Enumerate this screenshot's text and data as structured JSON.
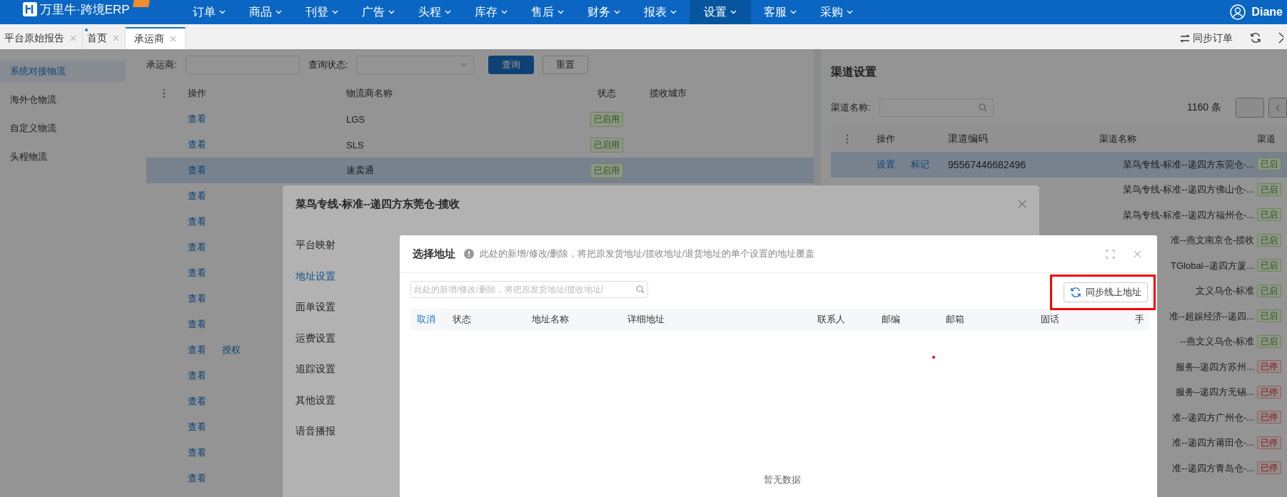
{
  "app": {
    "logo": "万里牛·跨境ERP",
    "user": "Diane"
  },
  "nav": [
    {
      "label": "订单",
      "selected": false
    },
    {
      "label": "商品",
      "selected": false
    },
    {
      "label": "刊登",
      "selected": false
    },
    {
      "label": "广告",
      "selected": false
    },
    {
      "label": "头程",
      "selected": false
    },
    {
      "label": "库存",
      "selected": false
    },
    {
      "label": "售后",
      "selected": false
    },
    {
      "label": "财务",
      "selected": false
    },
    {
      "label": "报表",
      "selected": false
    },
    {
      "label": "设置",
      "selected": true
    },
    {
      "label": "客服",
      "selected": false
    },
    {
      "label": "采购",
      "selected": false
    }
  ],
  "tabs": [
    {
      "label": "平台原始报告",
      "selected": false,
      "modified": false
    },
    {
      "label": "首页",
      "selected": false,
      "modified": true
    },
    {
      "label": "承运商",
      "selected": true,
      "modified": false
    }
  ],
  "tab_actions": {
    "sync": "同步订单"
  },
  "sidebar": {
    "items": [
      {
        "label": "系统对接物流",
        "selected": true
      },
      {
        "label": "海外仓物流",
        "selected": false
      },
      {
        "label": "自定义物流",
        "selected": false
      },
      {
        "label": "头程物流",
        "selected": false
      }
    ]
  },
  "carrier_search": {
    "carrier_label": "承运商:",
    "status_label": "查询状态:",
    "query": "查询",
    "reset": "重置"
  },
  "carrier_table": {
    "columns": [
      "操作",
      "物流商名称",
      "状态",
      "揽收城市"
    ],
    "rows": [
      {
        "actions": [
          "查看"
        ],
        "name": "LGS",
        "status": "已启用",
        "selected": false
      },
      {
        "actions": [
          "查看"
        ],
        "name": "SLS",
        "status": "已启用",
        "selected": false
      },
      {
        "actions": [
          "查看"
        ],
        "name": "速卖通",
        "status": "已启用",
        "selected": true
      },
      {
        "actions": [
          "查看"
        ],
        "selected": false
      },
      {
        "actions": [
          "查看"
        ],
        "selected": false
      },
      {
        "actions": [
          "查看"
        ],
        "selected": false
      },
      {
        "actions": [
          "查看"
        ],
        "selected": false
      },
      {
        "actions": [
          "查看"
        ],
        "selected": false
      },
      {
        "actions": [
          "查看"
        ],
        "selected": false
      },
      {
        "actions": [
          "查看",
          "授权"
        ],
        "selected": false
      },
      {
        "actions": [
          "查看"
        ],
        "selected": false
      },
      {
        "actions": [
          "查看"
        ],
        "selected": false
      },
      {
        "actions": [
          "查看"
        ],
        "selected": false
      },
      {
        "actions": [
          "查看"
        ],
        "selected": false
      },
      {
        "actions": [
          "查看"
        ],
        "selected": false
      }
    ]
  },
  "channel_panel": {
    "title": "渠道设置",
    "search_label": "渠道名称:",
    "total": "1160 条",
    "columns": [
      "操作",
      "渠道编码",
      "渠道名称",
      "渠道"
    ],
    "rows": [
      {
        "actions": [
          "设置",
          "标记"
        ],
        "code": "95567446682496",
        "name": "菜鸟专线-标准--递四方东莞仓-...",
        "status": "已启",
        "kind": "enabled",
        "selected": true
      },
      {
        "name": "菜鸟专线-标准--递四方佛山仓-...",
        "status": "已启",
        "kind": "enabled",
        "selected": false
      },
      {
        "name": "菜鸟专线-标准--递四方福州仓-...",
        "status": "已启",
        "kind": "enabled",
        "selected": false
      },
      {
        "name": "准--燕文南京仓-揽收",
        "status": "已启",
        "kind": "enabled",
        "selected": false
      },
      {
        "name": "TGlobal--递四方厦...",
        "status": "已启",
        "kind": "enabled",
        "selected": false
      },
      {
        "name": "文义乌仓-标准",
        "status": "已启",
        "kind": "enabled",
        "selected": false
      },
      {
        "name": "准--超娱经济--递四...",
        "status": "已启",
        "kind": "enabled",
        "selected": false
      },
      {
        "name": "--燕文义乌仓-标准",
        "status": "已启",
        "kind": "enabled",
        "selected": false
      },
      {
        "name": "服务--递四方苏州...",
        "status": "已停",
        "kind": "disabled",
        "selected": false
      },
      {
        "name": "服务--递四方无锡...",
        "status": "已停",
        "kind": "disabled",
        "selected": false
      },
      {
        "name": "准--递四方广州仓-...",
        "status": "已停",
        "kind": "disabled",
        "selected": false
      },
      {
        "name": "准--递四方莆田仓-...",
        "status": "已停",
        "kind": "disabled",
        "selected": false
      },
      {
        "name": "准--递四方青岛仓-...",
        "status": "已停",
        "kind": "disabled",
        "selected": false
      }
    ]
  },
  "carrier_dialog": {
    "title": "菜鸟专线-标准--递四方东莞仓-揽收",
    "menu": [
      {
        "label": "平台映射",
        "selected": false
      },
      {
        "label": "地址设置",
        "selected": true
      },
      {
        "label": "面单设置",
        "selected": false
      },
      {
        "label": "运费设置",
        "selected": false
      },
      {
        "label": "追踪设置",
        "selected": false
      },
      {
        "label": "其他设置",
        "selected": false
      },
      {
        "label": "语音播报",
        "selected": false
      }
    ]
  },
  "address_dialog": {
    "title": "选择地址",
    "hint": "此处的新增/修改/删除，将把原发货地址/揽收地址/退货地址的单个设置的地址覆盖",
    "search_placeholder": "此处的新增/修改/删除，将把原发货地址/揽收地址/",
    "sync_button": "同步线上地址",
    "cancel": "取消",
    "columns": [
      "状态",
      "地址名称",
      "详细地址",
      "联系人",
      "邮编",
      "邮箱",
      "固话",
      "手"
    ],
    "empty": "暂无数据"
  }
}
